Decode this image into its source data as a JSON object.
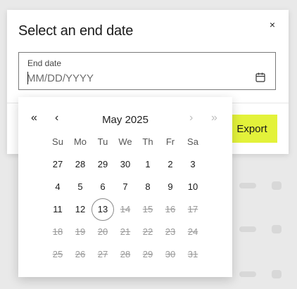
{
  "dialog": {
    "title": "Select an end date",
    "close_glyph": "×",
    "field_label": "End date",
    "input_placeholder": "MM/DD/YYYY",
    "input_value": "",
    "export_label": "Export",
    "accent_color": "#e3f23a"
  },
  "picker": {
    "month_label": "May 2025",
    "nav": {
      "prev_year": "«",
      "prev_month": "‹",
      "next_month": "›",
      "next_year": "»"
    },
    "weekdays": [
      "Su",
      "Mo",
      "Tu",
      "We",
      "Th",
      "Fr",
      "Sa"
    ],
    "weeks": [
      [
        {
          "d": "27",
          "disabled": false,
          "today": false
        },
        {
          "d": "28",
          "disabled": false,
          "today": false
        },
        {
          "d": "29",
          "disabled": false,
          "today": false
        },
        {
          "d": "30",
          "disabled": false,
          "today": false
        },
        {
          "d": "1",
          "disabled": false,
          "today": false
        },
        {
          "d": "2",
          "disabled": false,
          "today": false
        },
        {
          "d": "3",
          "disabled": false,
          "today": false
        }
      ],
      [
        {
          "d": "4",
          "disabled": false,
          "today": false
        },
        {
          "d": "5",
          "disabled": false,
          "today": false
        },
        {
          "d": "6",
          "disabled": false,
          "today": false
        },
        {
          "d": "7",
          "disabled": false,
          "today": false
        },
        {
          "d": "8",
          "disabled": false,
          "today": false
        },
        {
          "d": "9",
          "disabled": false,
          "today": false
        },
        {
          "d": "10",
          "disabled": false,
          "today": false
        }
      ],
      [
        {
          "d": "11",
          "disabled": false,
          "today": false
        },
        {
          "d": "12",
          "disabled": false,
          "today": false
        },
        {
          "d": "13",
          "disabled": false,
          "today": true
        },
        {
          "d": "14",
          "disabled": true,
          "today": false
        },
        {
          "d": "15",
          "disabled": true,
          "today": false
        },
        {
          "d": "16",
          "disabled": true,
          "today": false
        },
        {
          "d": "17",
          "disabled": true,
          "today": false
        }
      ],
      [
        {
          "d": "18",
          "disabled": true,
          "today": false
        },
        {
          "d": "19",
          "disabled": true,
          "today": false
        },
        {
          "d": "20",
          "disabled": true,
          "today": false
        },
        {
          "d": "21",
          "disabled": true,
          "today": false
        },
        {
          "d": "22",
          "disabled": true,
          "today": false
        },
        {
          "d": "23",
          "disabled": true,
          "today": false
        },
        {
          "d": "24",
          "disabled": true,
          "today": false
        }
      ],
      [
        {
          "d": "25",
          "disabled": true,
          "today": false
        },
        {
          "d": "26",
          "disabled": true,
          "today": false
        },
        {
          "d": "27",
          "disabled": true,
          "today": false
        },
        {
          "d": "28",
          "disabled": true,
          "today": false
        },
        {
          "d": "29",
          "disabled": true,
          "today": false
        },
        {
          "d": "30",
          "disabled": true,
          "today": false
        },
        {
          "d": "31",
          "disabled": true,
          "today": false
        }
      ]
    ]
  }
}
